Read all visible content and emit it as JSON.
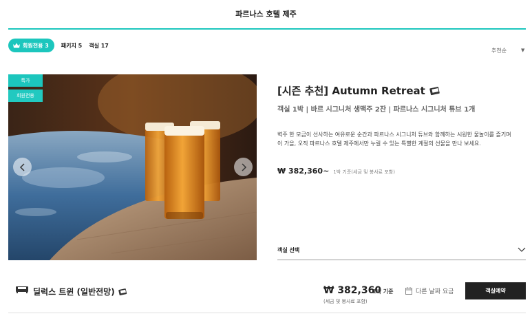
{
  "header": {
    "title": "파르나스 호텔 제주"
  },
  "tabs": [
    {
      "label": "회원전용 3",
      "active": true,
      "icon": "crown-icon"
    },
    {
      "label": "패키지 5",
      "active": false
    },
    {
      "label": "객실 17",
      "active": false
    }
  ],
  "sort": {
    "label": "추천순",
    "caret": "▼"
  },
  "package": {
    "badges": [
      "특가",
      "회원전용"
    ],
    "title": "[시즌 추천] Autumn Retreat",
    "subtitle": "객실 1박 | 바르 시그니처 생맥주 2잔 | 파르나스 시그니처 튜브 1개",
    "description": "벽주 한 모금이 선사하는 여유로운 순간과 파르나스 시그니처 튜브와 함께하는 시원한 물놀이를 즐기며 이 가을, 오직 파르나스 호텔 제주에서만 누릴 수 있는 특별한 계절의 선물을 만나 보세요.",
    "price": "₩ 382,360~",
    "price_note": "1박 기준(세금 및 봉사료 포함)",
    "room_select_label": "객실 선택"
  },
  "room": {
    "name": "딜럭스 트윈 (일반전망)",
    "price": "₩ 382,360",
    "per": "1박 기준",
    "tax": "(세금 및 봉사료 포함)",
    "other_dates": "다른 날짜 요금",
    "reserve_button": "객실예약"
  },
  "colors": {
    "accent": "#1cc6bd",
    "button": "#222222"
  }
}
